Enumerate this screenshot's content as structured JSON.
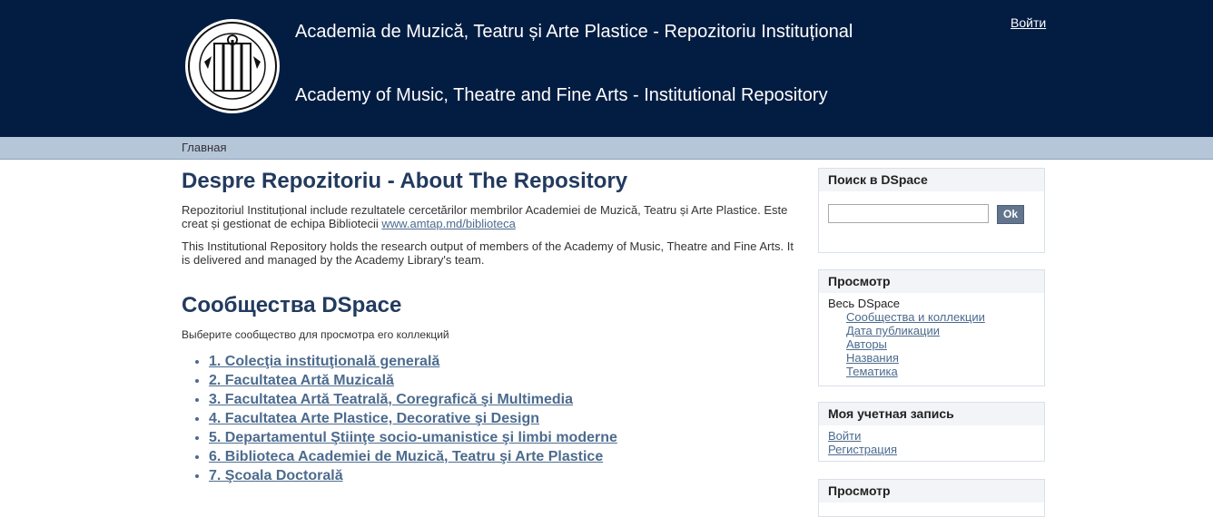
{
  "header": {
    "title_ro": "Academia de Muzică, Teatru și Arte Plastice - Repozitoriu Instituțional",
    "title_en": "Academy of Music, Theatre and Fine Arts - Institutional Repository",
    "login": "Войти",
    "logo_icon": "academy-seal-logo",
    "bg_color": "#031d42"
  },
  "breadcrumb": {
    "home": "Главная"
  },
  "main": {
    "about_title": "Despre Repozitoriu - About The Repository",
    "about_ro_text": "Repozitoriul Instituțional include rezultatele cercetărilor membrilor Academiei de Muzică, Teatru și Arte Plastice. Este creat și gestionat de echipa Bibliotecii ",
    "about_ro_link": "www.amtap.md/biblioteca",
    "about_en_text": "This Institutional Repository holds the research output of members of the Academy of Music, Theatre and Fine Arts. It is delivered and managed by the Academy Library's team.",
    "communities_title": "Сообщества DSpace",
    "communities_hint": "Выберите сообщество для просмотра его коллекций",
    "communities": [
      "1. Colecţia instituţională generală",
      "2. Facultatea Artă Muzicală",
      "3. Facultatea Artă Teatrală, Coregrafică şi Multimedia",
      "4. Facultatea Arte Plastice, Decorative şi Design",
      "5. Departamentul Ştiinţe socio-umanistice şi limbi moderne",
      "6. Biblioteca Academiei de Muzică, Teatru şi Arte Plastice",
      "7. Şcoala Doctorală"
    ]
  },
  "sidebar": {
    "search": {
      "title": "Поиск в DSpace",
      "button": "Ok"
    },
    "browse": {
      "title": "Просмотр",
      "all": "Весь DSpace",
      "items": [
        "Сообщества и коллекции",
        "Дата публикации",
        "Авторы",
        "Названия",
        "Тематика"
      ]
    },
    "account": {
      "title": "Моя учетная запись",
      "items": [
        "Войти",
        "Регистрация"
      ]
    },
    "browse2": {
      "title": "Просмотр"
    }
  }
}
